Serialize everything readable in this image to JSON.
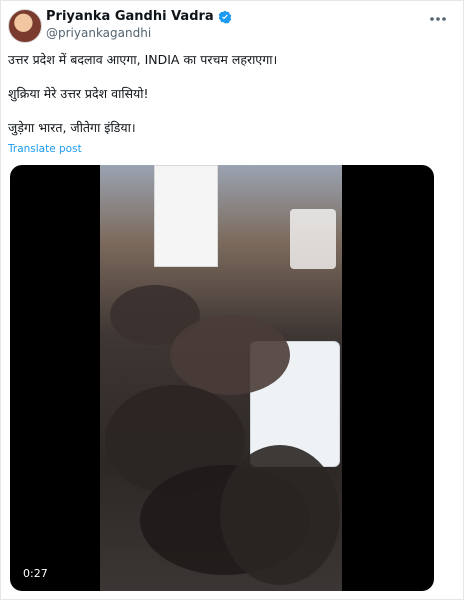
{
  "post": {
    "author": {
      "name": "Priyanka Gandhi Vadra",
      "handle": "@priyankagandhi"
    },
    "text_lines": [
      "उत्तर प्रदेश में बदलाव आएगा, INDIA का परचम लहराएगा।",
      "शुक्रिया मेरे उत्तर प्रदेश वासियो!",
      "जुड़ेगा भारत, जीतेगा इंडिया।"
    ],
    "translate_label": "Translate post",
    "video": {
      "duration": "0:27"
    }
  }
}
